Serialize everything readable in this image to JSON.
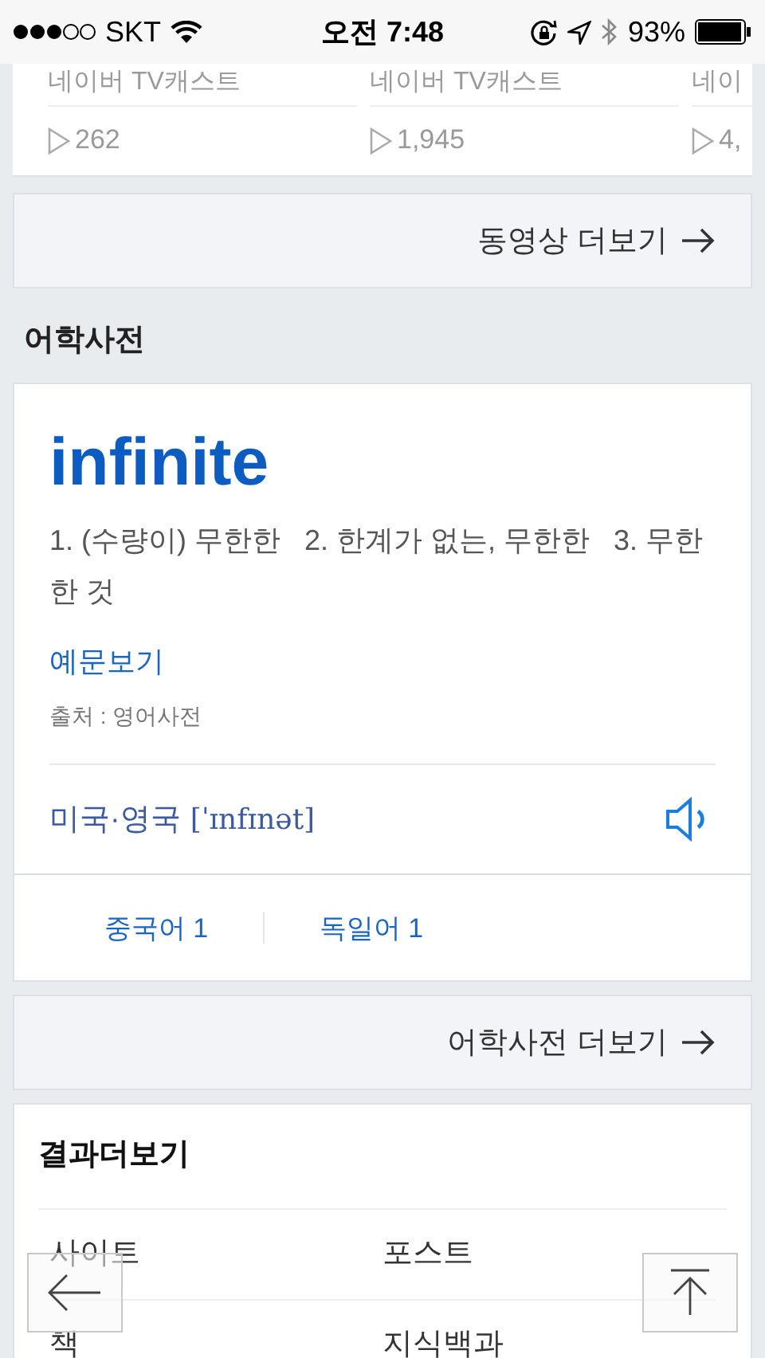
{
  "status_bar": {
    "carrier": "SKT",
    "time": "오전 7:48",
    "battery": "93%"
  },
  "videos": [
    {
      "source": "네이버 TV캐스트",
      "plays": "262"
    },
    {
      "source": "네이버 TV캐스트",
      "plays": "1,945"
    },
    {
      "source": "네이",
      "plays": "4,"
    }
  ],
  "video_more": {
    "label": "동영상 더보기"
  },
  "dictionary": {
    "section_title": "어학사전",
    "word": "infinite",
    "meaning": "1. (수량이) 무한한   2. 한계가 없는, 무한한   3. 무한한 것",
    "examples_link": "예문보기",
    "source": "출처 : 영어사전",
    "pronunciation_label": "미국·영국",
    "pronunciation": "[ˈɪnfɪnət]",
    "languages": [
      {
        "label": "중국어 1"
      },
      {
        "label": "독일어 1"
      }
    ]
  },
  "dictionary_more": {
    "label": "어학사전 더보기"
  },
  "more_results": {
    "title": "결과더보기",
    "items": [
      {
        "label": "사이트"
      },
      {
        "label": "포스트"
      },
      {
        "label": "책"
      },
      {
        "label": "지식백과"
      }
    ]
  }
}
